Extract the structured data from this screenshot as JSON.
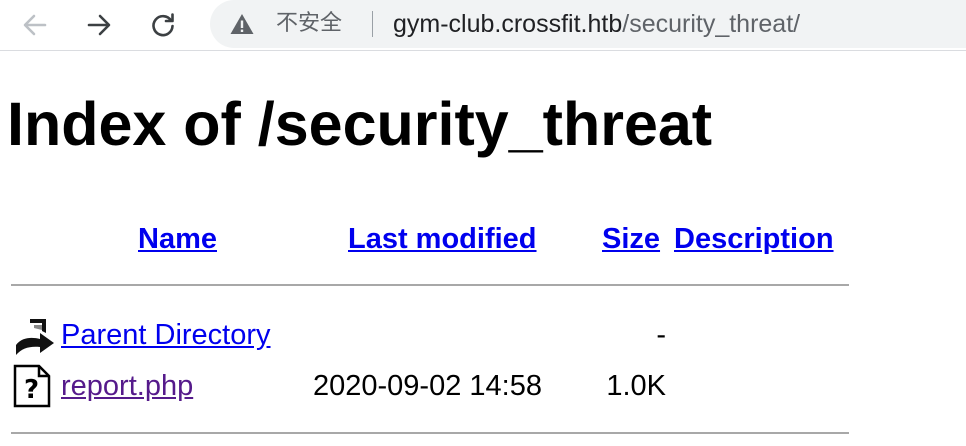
{
  "browser": {
    "back_icon": "arrow-left-icon",
    "forward_icon": "arrow-right-icon",
    "reload_icon": "reload-icon",
    "security_icon": "warning-triangle-icon",
    "security_label": "不安全",
    "url_host": "gym-club.crossfit.htb",
    "url_path": "/security_threat/"
  },
  "page": {
    "title": "Index of /security_threat"
  },
  "table": {
    "headers": {
      "name": "Name",
      "last_modified": "Last modified",
      "size": "Size",
      "description": "Description"
    },
    "rows": [
      {
        "icon": "parent-directory-icon",
        "name": "Parent Directory",
        "last_modified": "",
        "size": "-",
        "description": ""
      },
      {
        "icon": "unknown-file-icon",
        "name": "report.php",
        "last_modified": "2020-09-02 14:58",
        "size": "1.0K",
        "description": ""
      }
    ]
  },
  "colors": {
    "link": "#0000ee",
    "visited_link": "#551a8b",
    "omnibox_bg": "#f1f3f4",
    "rule": "#a8a8a8"
  }
}
